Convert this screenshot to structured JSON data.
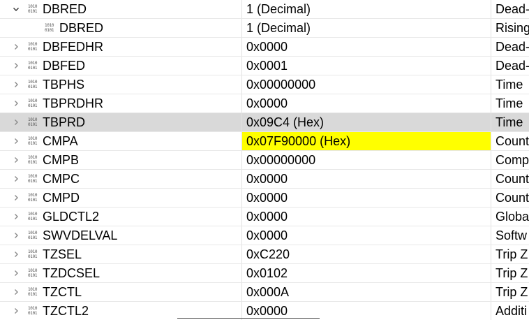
{
  "colors": {
    "selected_row": "#d9d9d9",
    "highlight": "#ffff00",
    "grid": "#e8e8e8",
    "icon": "#555555"
  },
  "icon": {
    "name": "register-binary-icon",
    "line1": "1010",
    "line2": "0101"
  },
  "rows": [
    {
      "name": "DBRED",
      "value": "1 (Decimal)",
      "desc": "Dead-",
      "level": 0,
      "expander": "expanded",
      "selected": false,
      "highlight": false
    },
    {
      "name": "DBRED",
      "value": "1 (Decimal)",
      "desc": "Rising",
      "level": 1,
      "expander": "none",
      "selected": false,
      "highlight": false
    },
    {
      "name": "DBFEDHR",
      "value": "0x0000",
      "desc": "Dead-",
      "level": 0,
      "expander": "collapsed",
      "selected": false,
      "highlight": false
    },
    {
      "name": "DBFED",
      "value": "0x0001",
      "desc": "Dead-",
      "level": 0,
      "expander": "collapsed",
      "selected": false,
      "highlight": false
    },
    {
      "name": "TBPHS",
      "value": "0x00000000",
      "desc": "Time",
      "level": 0,
      "expander": "collapsed",
      "selected": false,
      "highlight": false
    },
    {
      "name": "TBPRDHR",
      "value": "0x0000",
      "desc": "Time",
      "level": 0,
      "expander": "collapsed",
      "selected": false,
      "highlight": false
    },
    {
      "name": "TBPRD",
      "value": "0x09C4 (Hex)",
      "desc": "Time",
      "level": 0,
      "expander": "collapsed",
      "selected": true,
      "highlight": false
    },
    {
      "name": "CMPA",
      "value": "0x07F90000 (Hex)",
      "desc": "Count",
      "level": 0,
      "expander": "collapsed",
      "selected": false,
      "highlight": true
    },
    {
      "name": "CMPB",
      "value": "0x00000000",
      "desc": "Comp",
      "level": 0,
      "expander": "collapsed",
      "selected": false,
      "highlight": false
    },
    {
      "name": "CMPC",
      "value": "0x0000",
      "desc": "Count",
      "level": 0,
      "expander": "collapsed",
      "selected": false,
      "highlight": false
    },
    {
      "name": "CMPD",
      "value": "0x0000",
      "desc": "Count",
      "level": 0,
      "expander": "collapsed",
      "selected": false,
      "highlight": false
    },
    {
      "name": "GLDCTL2",
      "value": "0x0000",
      "desc": "Globa",
      "level": 0,
      "expander": "collapsed",
      "selected": false,
      "highlight": false
    },
    {
      "name": "SWVDELVAL",
      "value": "0x0000",
      "desc": "Softw",
      "level": 0,
      "expander": "collapsed",
      "selected": false,
      "highlight": false
    },
    {
      "name": "TZSEL",
      "value": "0xC220",
      "desc": "Trip Z",
      "level": 0,
      "expander": "collapsed",
      "selected": false,
      "highlight": false
    },
    {
      "name": "TZDCSEL",
      "value": "0x0102",
      "desc": "Trip Z",
      "level": 0,
      "expander": "collapsed",
      "selected": false,
      "highlight": false
    },
    {
      "name": "TZCTL",
      "value": "0x000A",
      "desc": "Trip Z",
      "level": 0,
      "expander": "collapsed",
      "selected": false,
      "highlight": false
    },
    {
      "name": "TZCTL2",
      "value": "0x0000",
      "desc": "Additi",
      "level": 0,
      "expander": "collapsed",
      "selected": false,
      "highlight": false
    }
  ]
}
